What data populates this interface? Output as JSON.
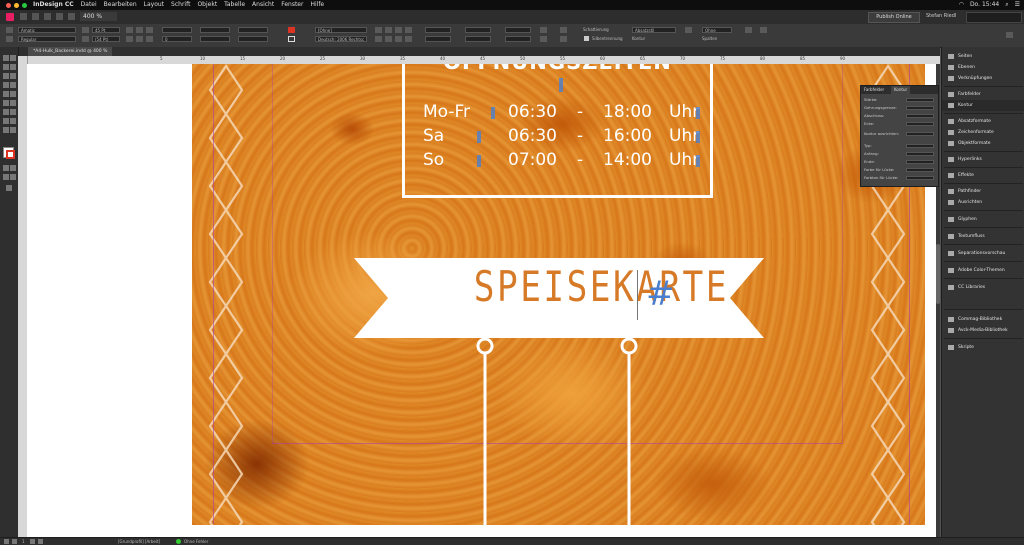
{
  "menubar": {
    "app": "InDesign CC",
    "items": [
      "Datei",
      "Bearbeiten",
      "Layout",
      "Schrift",
      "Objekt",
      "Tabelle",
      "Ansicht",
      "Fenster",
      "Hilfe"
    ],
    "clock": "Do. 15:44",
    "status_colors": {
      "close": "#fe5f57",
      "minimize": "#febc2e",
      "zoom": "#28c840"
    }
  },
  "topbar": {
    "zoom": "400 %",
    "publish": "Publish Online",
    "user": "Stefan Riedl"
  },
  "control": {
    "font": "Amatic",
    "style": "Regular",
    "size": "45 Pt",
    "leading": "(54 Pt)",
    "para_style": "Absatzstil",
    "char_style": "[Ohne]",
    "language": "Deutsch: 2006 Rechtsc",
    "tracking": "0",
    "alignment": "Schattierung",
    "border": "Kontur",
    "columns_label": "Spalten",
    "width_label": "Silbentrennung",
    "option": "Ohne"
  },
  "doc_tab": {
    "label": "*A4-Hulk_Backerei.indd @ 400 %"
  },
  "ruler": {
    "ticks": [
      "5",
      "10",
      "15",
      "20",
      "25",
      "30",
      "35",
      "40",
      "45",
      "50",
      "55",
      "60",
      "65",
      "70",
      "75",
      "80",
      "85",
      "90"
    ]
  },
  "document": {
    "hours_title": "ÖFFNUNGSZEITEN",
    "hours": [
      {
        "day": "Mo-Fr",
        "from": "06:30",
        "dash": "-",
        "to": "18:00",
        "unit": "Uhr"
      },
      {
        "day": "Sa",
        "from": "06:30",
        "dash": "-",
        "to": "16:00",
        "unit": "Uhr"
      },
      {
        "day": "So",
        "from": "07:00",
        "dash": "-",
        "to": "14:00",
        "unit": "Uhr"
      }
    ],
    "banner_title": "SPEISEKARTE",
    "hash_mark": "#"
  },
  "float_panel": {
    "tabs": [
      "Farbfelder",
      "Kontur"
    ],
    "rows": [
      "Stärke:",
      "Gehrungsgrenze:",
      "Abschluss:",
      "Ecke:",
      "Kontur ausrichten:",
      "Typ:",
      "Anfang:",
      "Ende:",
      "Farbe für Lücke:",
      "Farbton für Lücke:"
    ]
  },
  "right_panel": {
    "items": [
      "Seiten",
      "Ebenen",
      "Verknüpfungen",
      "Farbfelder",
      "Kontur",
      "Absatzformate",
      "Zeichenformate",
      "Objektformate",
      "Hyperlinks",
      "Effekte",
      "Pathfinder",
      "Ausrichten",
      "Glyphen",
      "Textumfluss",
      "Separationsvorschau",
      "Adobe Color-Themen",
      "CC Libraries",
      "Commag-Bibliothek",
      "Avck-Media-Bibliothek",
      "Skripte"
    ]
  },
  "statusbar": {
    "page": "1",
    "master": "[Grundprofil] [Arbeit]",
    "errors": "Ohne Fehler"
  }
}
